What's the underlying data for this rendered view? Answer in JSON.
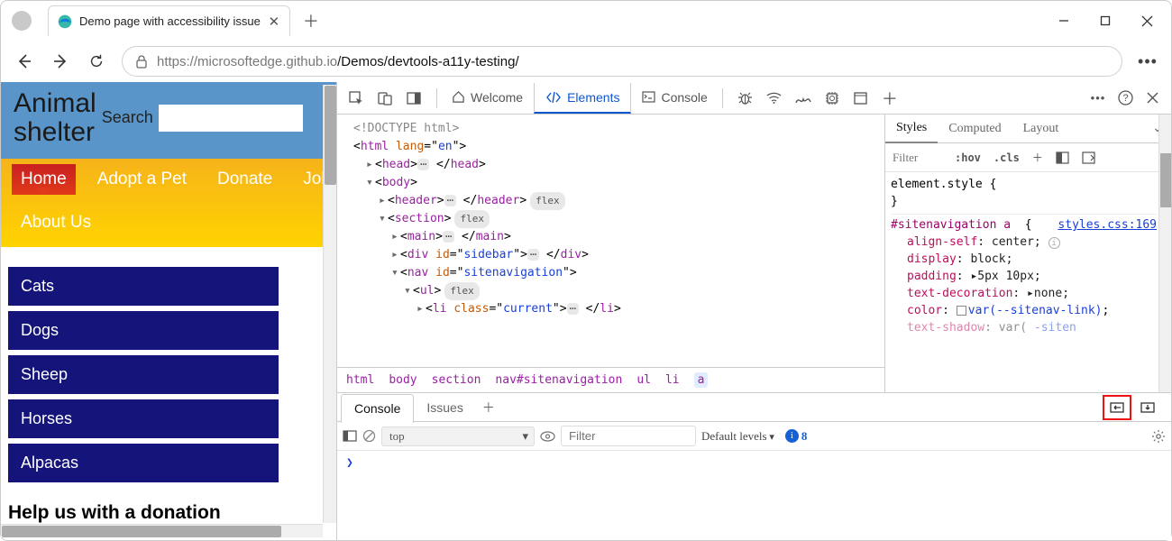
{
  "browser": {
    "tab_title": "Demo page with accessibility issue",
    "url_left": "https://microsoftedge.github.io",
    "url_slug": "/Demos/devtools-a11y-testing/"
  },
  "page": {
    "app_title_1": "Animal",
    "app_title_2": "shelter",
    "search_label": "Search",
    "nav": [
      "Home",
      "Adopt a Pet",
      "Donate",
      "Jobs",
      "About Us"
    ],
    "nav_current": 0,
    "side": [
      "Cats",
      "Dogs",
      "Sheep",
      "Horses",
      "Alpacas"
    ],
    "donate_heading": "Help us with a donation"
  },
  "devtools": {
    "tabs": {
      "welcome": "Welcome",
      "elements": "Elements",
      "console": "Console"
    },
    "dom": {
      "l0": "<!DOCTYPE html>",
      "crumbs": [
        "html",
        "body",
        "section",
        "nav#sitenavigation",
        "ul",
        "li",
        "a"
      ]
    },
    "styles": {
      "tabs": [
        "Styles",
        "Computed",
        "Layout"
      ],
      "filter_ph": "Filter",
      "hov": ":hov",
      "cls": ".cls",
      "r0": "element.style {",
      "r0c": "}",
      "selector": "#sitenavigation a",
      "brace": "{",
      "src": "styles.css:169",
      "props": [
        [
          "align-self",
          ": center;"
        ],
        [
          "display",
          ": block;"
        ],
        [
          "padding",
          ": ▸5px 10px;"
        ],
        [
          "text-decoration",
          ": ▸none;"
        ],
        [
          "color",
          ": "
        ],
        [
          "text-shadow",
          ": var("
        ]
      ],
      "color_var": "var(--sitenav-link)",
      "color_end": ";"
    },
    "drawer": {
      "tabs": [
        "Console",
        "Issues"
      ],
      "context": "top",
      "filter_ph": "Filter",
      "levels": "Default levels",
      "issue_count": "8",
      "prompt": "❯"
    }
  }
}
